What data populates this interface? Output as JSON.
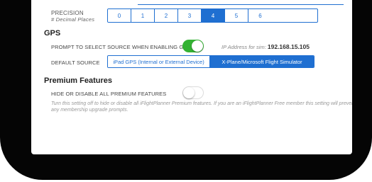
{
  "precision": {
    "label": "PRECISION",
    "sublabel": "# Decimal Places",
    "options": [
      "0",
      "1",
      "2",
      "3",
      "4",
      "5",
      "6"
    ],
    "selected": "4"
  },
  "gps": {
    "title": "GPS",
    "prompt_label": "PROMPT TO SELECT SOURCE WHEN ENABLING GPS",
    "prompt_enabled": true,
    "ip_label": "IP Address for sim:",
    "ip_value": "192.168.15.105",
    "default_source_label": "DEFAULT SOURCE",
    "source_options": [
      "iPad GPS (Internal or External Device)",
      "X-Plane/Microsoft Flight Simulator"
    ],
    "source_selected": "X-Plane/Microsoft Flight Simulator"
  },
  "premium": {
    "title": "Premium Features",
    "hide_label": "HIDE OR DISABLE ALL PREMIUM FEATURES",
    "hide_enabled": false,
    "help_text": "Turn this setting off to hide or disable all iFlightPlanner Premium features. If you are an iFlightPlanner Free member this setting will prevent any membership upgrade prompts."
  },
  "colors": {
    "accent": "#1f6fd1",
    "toggle_on": "#34b233",
    "bezel": "#050505"
  }
}
